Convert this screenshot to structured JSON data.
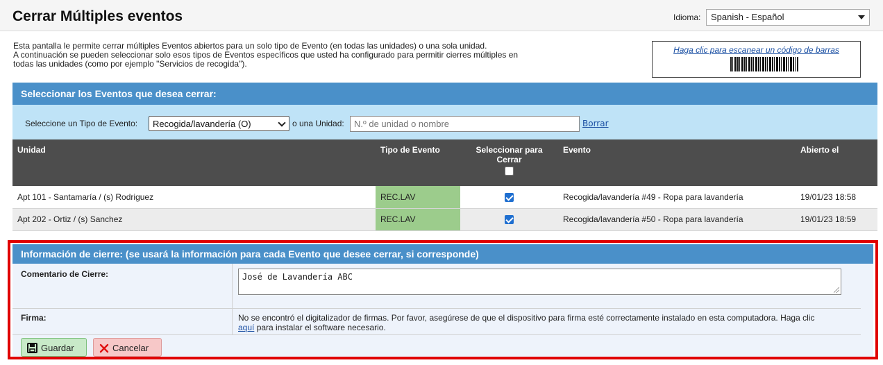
{
  "header": {
    "title": "Cerrar Múltiples eventos",
    "language_label": "Idioma:",
    "language_value": "Spanish - Español"
  },
  "intro": {
    "line1": "Esta pantalla le permite cerrar múltiples Eventos abiertos para un solo tipo de Evento (en todas las unidades) o una sola unidad.",
    "line2": "A continuación se pueden seleccionar solo esos tipos de Eventos específicos que usted ha configurado para permitir cierres múltiples en",
    "line3": "todas las unidades (como por ejemplo \"Servicios de recogida\")."
  },
  "barcode": {
    "link": "Haga clic para escanear un código de barras"
  },
  "select_section": {
    "title": "Seleccionar los Eventos que desea cerrar:",
    "type_label": "Seleccione un Tipo de Evento:",
    "type_value": "Recogida/lavandería (O)",
    "unit_label": "o una Unidad:",
    "unit_placeholder": "N.º de unidad o nombre",
    "clear_link": "Borrar"
  },
  "table": {
    "columns": {
      "unit": "Unidad",
      "type": "Tipo de Evento",
      "select": "Seleccionar para Cerrar",
      "event": "Evento",
      "opened": "Abierto el"
    },
    "rows": [
      {
        "unit": "Apt 101 - Santamaría / (s) Rodriguez",
        "type": "REC.LAV",
        "checked": true,
        "event": "Recogida/lavandería #49 - Ropa para lavandería",
        "opened": "19/01/23 18:58"
      },
      {
        "unit": "Apt 202 - Ortiz / (s) Sanchez",
        "type": "REC.LAV",
        "checked": true,
        "event": "Recogida/lavandería #50 - Ropa para lavandería",
        "opened": "19/01/23 18:59"
      }
    ]
  },
  "close_section": {
    "title": "Información de cierre: (se usará la información para cada Evento que desee cerrar, si corresponde)",
    "comment_label": "Comentario de Cierre:",
    "comment_value": "José de Lavandería ABC",
    "signature_label": "Firma:",
    "signature_text_1": "No se encontró el digitalizador de firmas. Por favor, asegúrese de que el dispositivo para firma esté correctamente instalado en esta computadora. Haga clic",
    "signature_link": "aquí",
    "signature_text_2": "para instalar el software necesario.",
    "save_label": "Guardar",
    "cancel_label": "Cancelar"
  },
  "colors": {
    "section_header": "#4a90c9",
    "filter_bg": "#bfe3f7",
    "table_header": "#4d4d4d",
    "type_cell": "#9ccc8c",
    "highlight_border": "#e00000"
  }
}
